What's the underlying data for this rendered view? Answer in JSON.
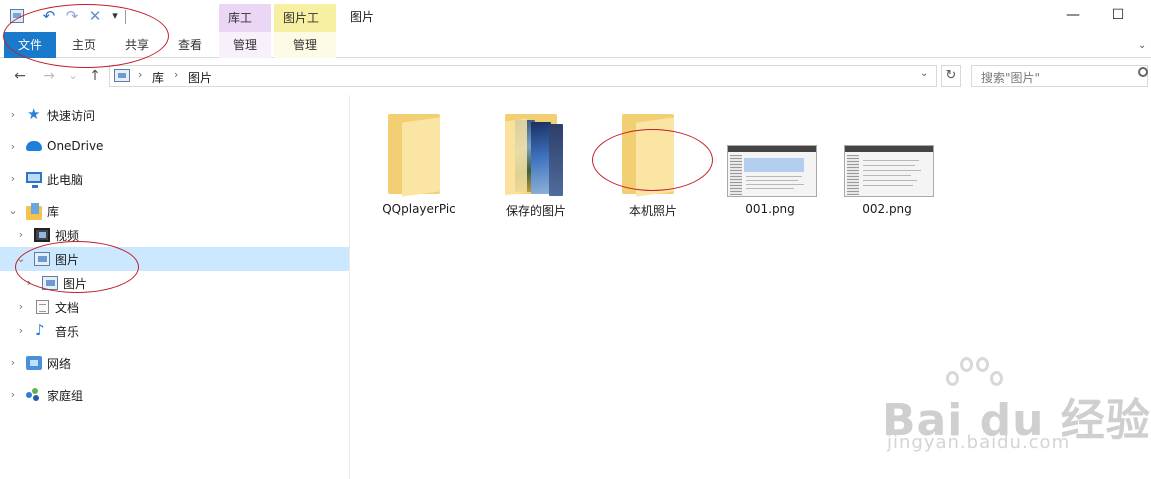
{
  "window": {
    "title": "图片",
    "minimize_glyph": "—",
    "maximize_glyph": "☐",
    "expand_glyph": "⌄"
  },
  "quick_access_toolbar": {
    "undo_glyph": "↶",
    "redo_glyph": "↷",
    "delete_glyph": "✕",
    "dropdown_glyph": "▾"
  },
  "context_tabs": {
    "library_tools": "库工具",
    "picture_tools": "图片工具"
  },
  "ribbon_tabs": {
    "file": "文件",
    "home": "主页",
    "share": "共享",
    "view": "查看",
    "manage_library": "管理",
    "manage_picture": "管理"
  },
  "navigation": {
    "back_glyph": "←",
    "forward_glyph": "→",
    "recent_glyph": "⌄",
    "up_glyph": "↑",
    "breadcrumb": [
      "库",
      "图片"
    ],
    "crumb_separator": "›",
    "address_dropdown_glyph": "⌄",
    "refresh_glyph": "↻",
    "search_placeholder": "搜索\"图片\""
  },
  "nav_tree": {
    "expander_collapsed": "›",
    "expander_expanded": "⌄",
    "quick_access": "快速访问",
    "onedrive": "OneDrive",
    "this_pc": "此电脑",
    "libraries": "库",
    "videos": "视频",
    "pictures": "图片",
    "pictures_sub": "图片",
    "documents": "文档",
    "music": "音乐",
    "network": "网络",
    "homegroup": "家庭组",
    "star_glyph": "★",
    "music_glyph": "♪"
  },
  "files": [
    {
      "name": "QQplayerPic",
      "kind": "folder"
    },
    {
      "name": "保存的图片",
      "kind": "folder-photos"
    },
    {
      "name": "本机照片",
      "kind": "folder"
    },
    {
      "name": "001.png",
      "kind": "image"
    },
    {
      "name": "002.png",
      "kind": "image"
    }
  ],
  "watermark": {
    "brand": "Bai du 经验",
    "site": "jingyan.baidu.com"
  },
  "colors": {
    "file_tab": "#1979ca",
    "selection": "#cce8ff",
    "library_tools": "#ecd6f5",
    "picture_tools": "#f7f0a3",
    "folder": "#f2cf73",
    "annotation": "#c0202a"
  }
}
